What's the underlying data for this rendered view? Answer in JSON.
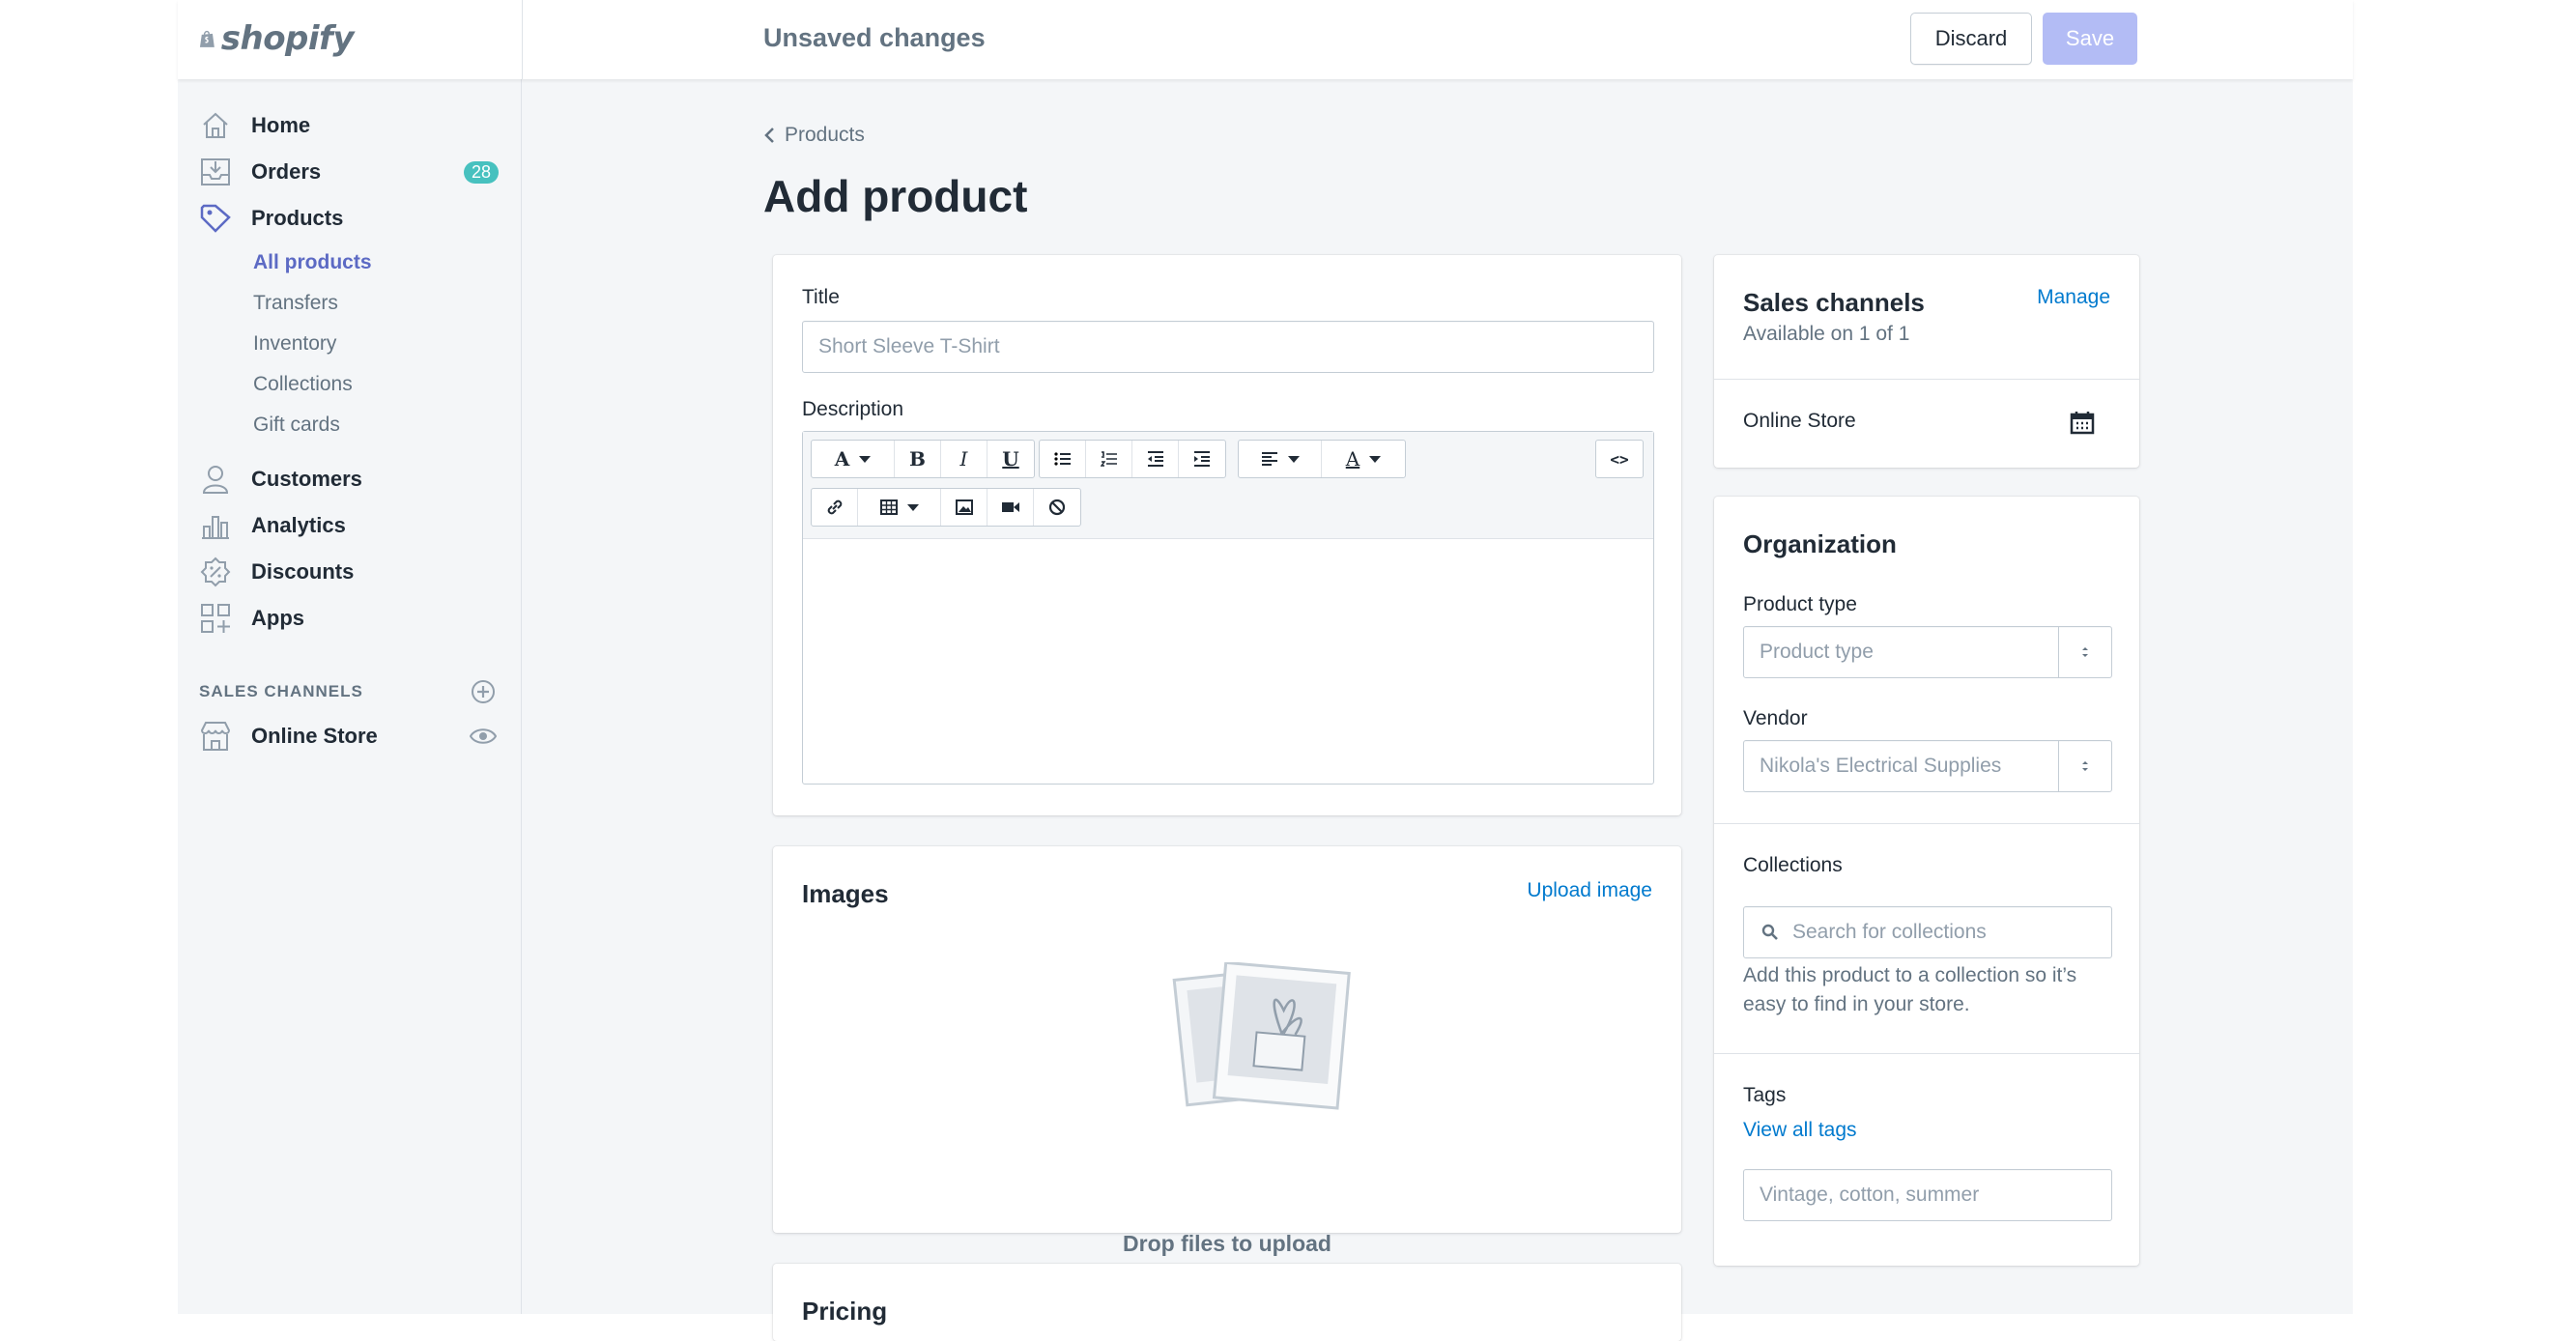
{
  "brand": {
    "name": "shopify"
  },
  "topbar": {
    "status": "Unsaved changes",
    "discard_label": "Discard",
    "save_label": "Save"
  },
  "sidebar": {
    "items": [
      {
        "label": "Home",
        "icon": "home-icon"
      },
      {
        "label": "Orders",
        "icon": "orders-icon",
        "badge": "28"
      },
      {
        "label": "Products",
        "icon": "tag-icon"
      },
      {
        "label": "Customers",
        "icon": "customer-icon"
      },
      {
        "label": "Analytics",
        "icon": "analytics-icon"
      },
      {
        "label": "Discounts",
        "icon": "discount-icon"
      },
      {
        "label": "Apps",
        "icon": "apps-icon"
      }
    ],
    "product_subitems": [
      "All products",
      "Transfers",
      "Inventory",
      "Collections",
      "Gift cards"
    ],
    "sales_channels_heading": "SALES CHANNELS",
    "online_store": "Online Store"
  },
  "breadcrumb": {
    "label": "Products"
  },
  "page": {
    "title": "Add product"
  },
  "product_form": {
    "title_label": "Title",
    "title_placeholder": "Short Sleeve T-Shirt",
    "description_label": "Description",
    "toolbar_icons": [
      "font-icon",
      "bold-icon",
      "italic-icon",
      "underline-icon",
      "bullet-list-icon",
      "numbered-list-icon",
      "outdent-icon",
      "indent-icon",
      "align-icon",
      "text-color-icon",
      "code-icon",
      "link-icon",
      "table-icon",
      "image-icon",
      "video-icon",
      "clear-format-icon"
    ]
  },
  "images": {
    "title": "Images",
    "upload_label": "Upload image",
    "drop_label": "Drop files to upload"
  },
  "pricing": {
    "title": "Pricing"
  },
  "sales_channels": {
    "title": "Sales channels",
    "manage_label": "Manage",
    "availability": "Available on 1 of 1",
    "channel": "Online Store"
  },
  "organization": {
    "title": "Organization",
    "product_type_label": "Product type",
    "product_type_placeholder": "Product type",
    "vendor_label": "Vendor",
    "vendor_placeholder": "Nikola's Electrical Supplies",
    "collections_label": "Collections",
    "collections_placeholder": "Search for collections",
    "collections_help_1": "Add this product to a collection so it’s",
    "collections_help_2": "easy to find in your store.",
    "tags_label": "Tags",
    "view_tags_label": "View all tags",
    "tags_placeholder": "Vintage, cotton, summer"
  },
  "colors": {
    "accent": "#5c6ac4",
    "link": "#007ace",
    "badge": "#47c1bf",
    "save_disabled": "#b3bcf5"
  }
}
